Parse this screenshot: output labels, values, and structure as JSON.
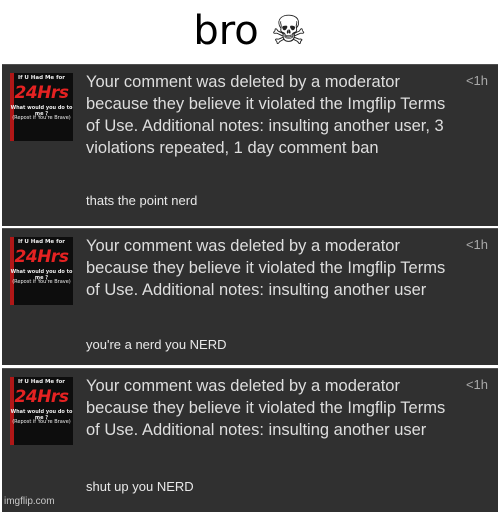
{
  "header": {
    "caption": "bro",
    "emoji": "☠"
  },
  "thumbnail": {
    "line1": "If U Had Me for",
    "line2": "24Hrs",
    "line3": "What would you do to me ?",
    "line4": "(Repost if You're Brave)"
  },
  "notifications": [
    {
      "message": "Your comment was deleted by a moderator because they believe it violated the Imgflip Terms of Use. Additional notes: insulting another user, 3 violations repeated, 1 day comment ban",
      "reply": "thats the point nerd",
      "time": "<1h"
    },
    {
      "message": "Your comment was deleted by a moderator because they believe it violated the Imgflip Terms of Use. Additional notes: insulting another user",
      "reply": "you're a nerd you NERD",
      "time": "<1h"
    },
    {
      "message": "Your comment was deleted by a moderator because they believe it violated the Imgflip Terms of Use. Additional notes: insulting another user",
      "reply": "shut up you NERD",
      "time": "<1h"
    }
  ],
  "watermark": "imgflip.com",
  "colors": {
    "panel": "#303030",
    "text": "#dedede",
    "accent": "#e52222"
  }
}
